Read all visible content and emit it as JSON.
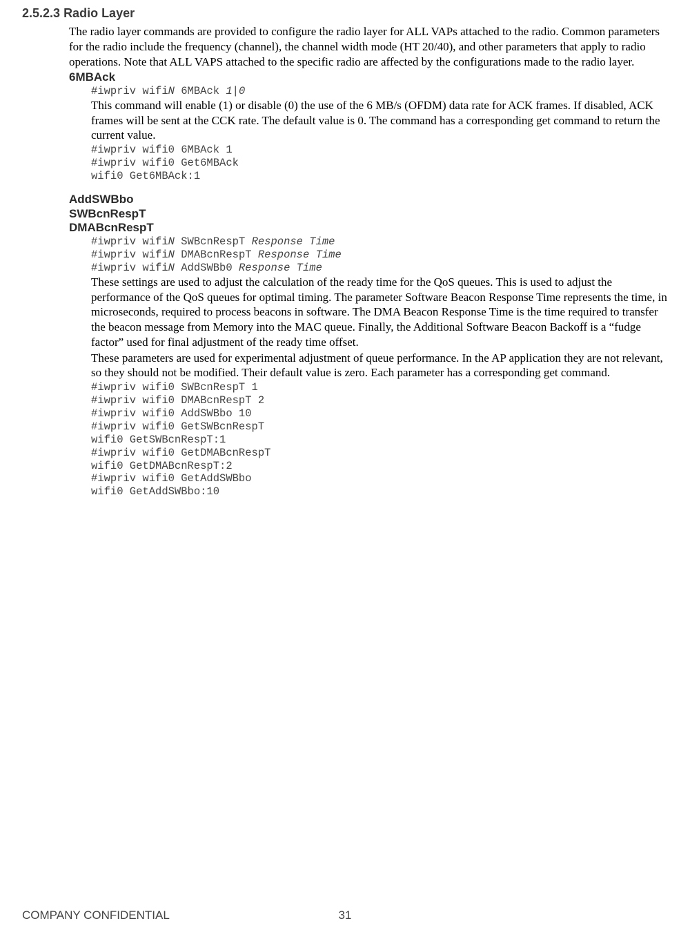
{
  "section": {
    "number": "2.5.2.3",
    "title": "Radio Layer",
    "intro": "The radio layer commands are provided to configure the radio layer for ALL VAPs attached to the radio. Common parameters for the radio include the frequency (channel), the channel width mode (HT 20/40), and other parameters that apply to radio operations. Note that ALL VAPS attached to the specific radio are affected by the configurations made to the radio layer."
  },
  "cmd1": {
    "name": "6MBAck",
    "syntax_prefix": "#iwpriv wifi",
    "syntax_n": "N",
    "syntax_mid": " 6MBAck ",
    "syntax_arg": "1|0",
    "desc": "This command will enable (1) or disable (0) the use of the 6 MB/s (OFDM) data rate for ACK frames. If disabled, ACK frames will be sent at the CCK rate. The default value is 0. The command has a corresponding get command to return the current value.",
    "example": "#iwpriv wifi0 6MBAck 1\n#iwpriv wifi0 Get6MBAck\nwifi0 Get6MBAck:1"
  },
  "cmd2": {
    "name1": "AddSWBbo",
    "name2": "SWBcnRespT",
    "name3": "DMABcnRespT",
    "syntax1_a": "#iwpriv wifi",
    "syntax1_n": "N",
    "syntax1_b": " SWBcnRespT ",
    "syntax1_c": "Response Time",
    "syntax2_a": "#iwpriv wifi",
    "syntax2_n": "N",
    "syntax2_b": " DMABcnRespT ",
    "syntax2_c": "Response Time",
    "syntax3_a": "#iwpriv wifi",
    "syntax3_n": "N",
    "syntax3_b": " AddSWBb0 ",
    "syntax3_c": "Response Time",
    "desc1": "These settings are used to adjust the calculation of the ready time for the QoS queues. This is used to adjust the performance of the QoS queues for optimal timing. The parameter Software Beacon Response Time represents the time, in microseconds, required to process beacons in software. The DMA Beacon Response Time is the time required to transfer the beacon message from Memory into the MAC queue. Finally, the Additional Software Beacon Backoff is a “fudge factor” used for final adjustment of the ready time offset.",
    "desc2": "These parameters are used for experimental adjustment of queue performance. In the AP application they are not relevant, so they should not be modified. Their default value is zero. Each parameter has a corresponding get command.",
    "example": "#iwpriv wifi0 SWBcnRespT 1\n#iwpriv wifi0 DMABcnRespT 2\n#iwpriv wifi0 AddSWBbo 10\n#iwpriv wifi0 GetSWBcnRespT\nwifi0 GetSWBcnRespT:1\n#iwpriv wifi0 GetDMABcnRespT\nwifi0 GetDMABcnRespT:2\n#iwpriv wifi0 GetAddSWBbo\nwifi0 GetAddSWBbo:10"
  },
  "footer": {
    "left": "COMPANY CONFIDENTIAL",
    "page": "31"
  }
}
